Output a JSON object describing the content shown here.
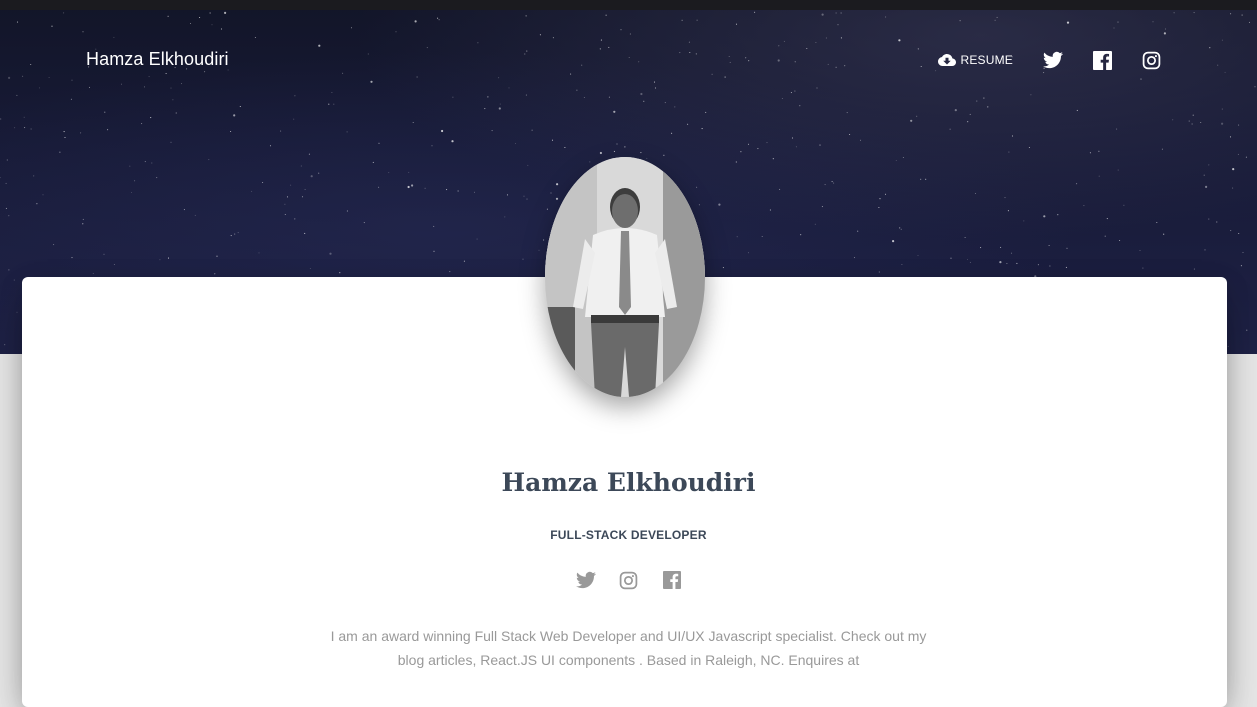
{
  "header": {
    "brand": "Hamza Elkhoudiri",
    "nav": {
      "resume_label": "RESUME",
      "items": [
        {
          "icon": "cloud-download-icon",
          "label": "RESUME"
        },
        {
          "icon": "twitter-icon"
        },
        {
          "icon": "facebook-icon"
        },
        {
          "icon": "instagram-icon"
        }
      ]
    }
  },
  "profile": {
    "name": "Hamza Elkhoudiri",
    "title": "FULL-STACK DEVELOPER",
    "socials": [
      "twitter-icon",
      "instagram-icon",
      "facebook-icon"
    ],
    "bio": "I am an award winning Full Stack Web Developer and UI/UX Javascript specialist. Check out my blog articles, React.JS UI components . Based in Raleigh, NC. Enquires at"
  },
  "colors": {
    "hero_dark": "#171a36",
    "card_bg": "#ffffff",
    "heading": "#3c4858",
    "muted_text": "#999999",
    "social_icon": "#999999"
  }
}
